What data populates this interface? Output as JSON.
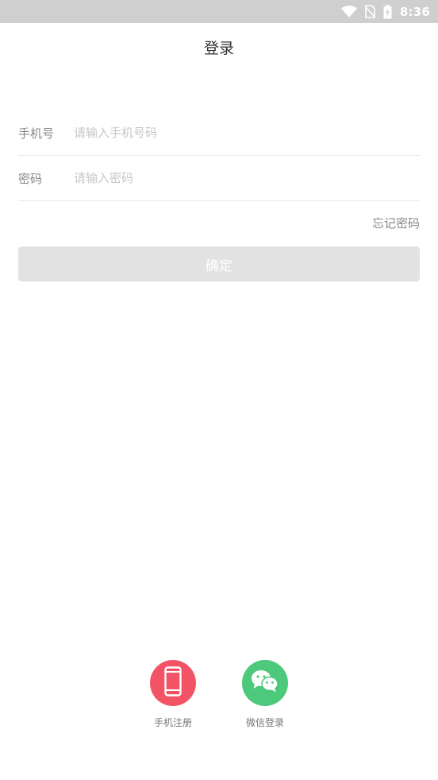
{
  "status_bar": {
    "time": "8:36",
    "icons": [
      "wifi-icon",
      "no-sim-icon",
      "battery-charging-icon"
    ]
  },
  "header": {
    "title": "登录"
  },
  "form": {
    "phone": {
      "label": "手机号",
      "placeholder": "请输入手机号码",
      "value": ""
    },
    "password": {
      "label": "密码",
      "placeholder": "请输入密码",
      "value": ""
    },
    "forgot_label": "忘记密码",
    "confirm_label": "确定"
  },
  "bottom_options": {
    "phone_register": {
      "label": "手机注册",
      "icon": "mobile-phone-icon",
      "color": "#f25466"
    },
    "wechat_login": {
      "label": "微信登录",
      "icon": "wechat-icon",
      "color": "#4cc97a"
    }
  },
  "colors": {
    "status_bar": "#cfcfcf",
    "button_disabled": "#e2e2e2",
    "divider": "#e8e8e8"
  }
}
